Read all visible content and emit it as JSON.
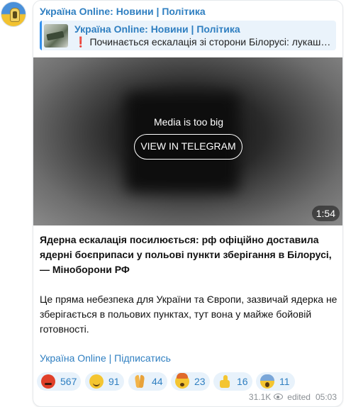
{
  "channel": {
    "name": "Україна Online: Новини | Політика"
  },
  "reply": {
    "title": "Україна Online: Новини | Політика",
    "icon": "❗",
    "text": "Починається ескалація зі сторони Білорусі: лукаш…"
  },
  "media": {
    "notice": "Media is too big",
    "button_label": "VIEW IN TELEGRAM",
    "duration": "1:54"
  },
  "post": {
    "bold_text": "Ядерна ескалація посилюється: рф офіційно доставила ядерні боєприпаси у польові пункти зберігання в Білорусі, — Міноборони РФ",
    "body_text": "Це пряма небезпека для України та Європи, зазвичай ядерка не зберігається в польових пунктах, тут вона у майже бойовій готовності.",
    "subscribe_link": "Україна Online | Підписатись"
  },
  "reactions": [
    {
      "icon": "angry-face-icon",
      "count": "567"
    },
    {
      "icon": "grinning-face-icon",
      "count": "91"
    },
    {
      "icon": "folded-hands-icon",
      "count": "44"
    },
    {
      "icon": "exploding-head-icon",
      "count": "23"
    },
    {
      "icon": "thumbs-up-icon",
      "count": "16"
    },
    {
      "icon": "screaming-face-icon",
      "count": "11"
    }
  ],
  "meta": {
    "views": "31.1K",
    "edited_label": "edited",
    "time": "05:03"
  },
  "colors": {
    "link": "#2f7fc1",
    "reaction_bg": "#e8f2fb",
    "reply_bg": "#eaf3fb",
    "reply_bar": "#3390ec"
  }
}
